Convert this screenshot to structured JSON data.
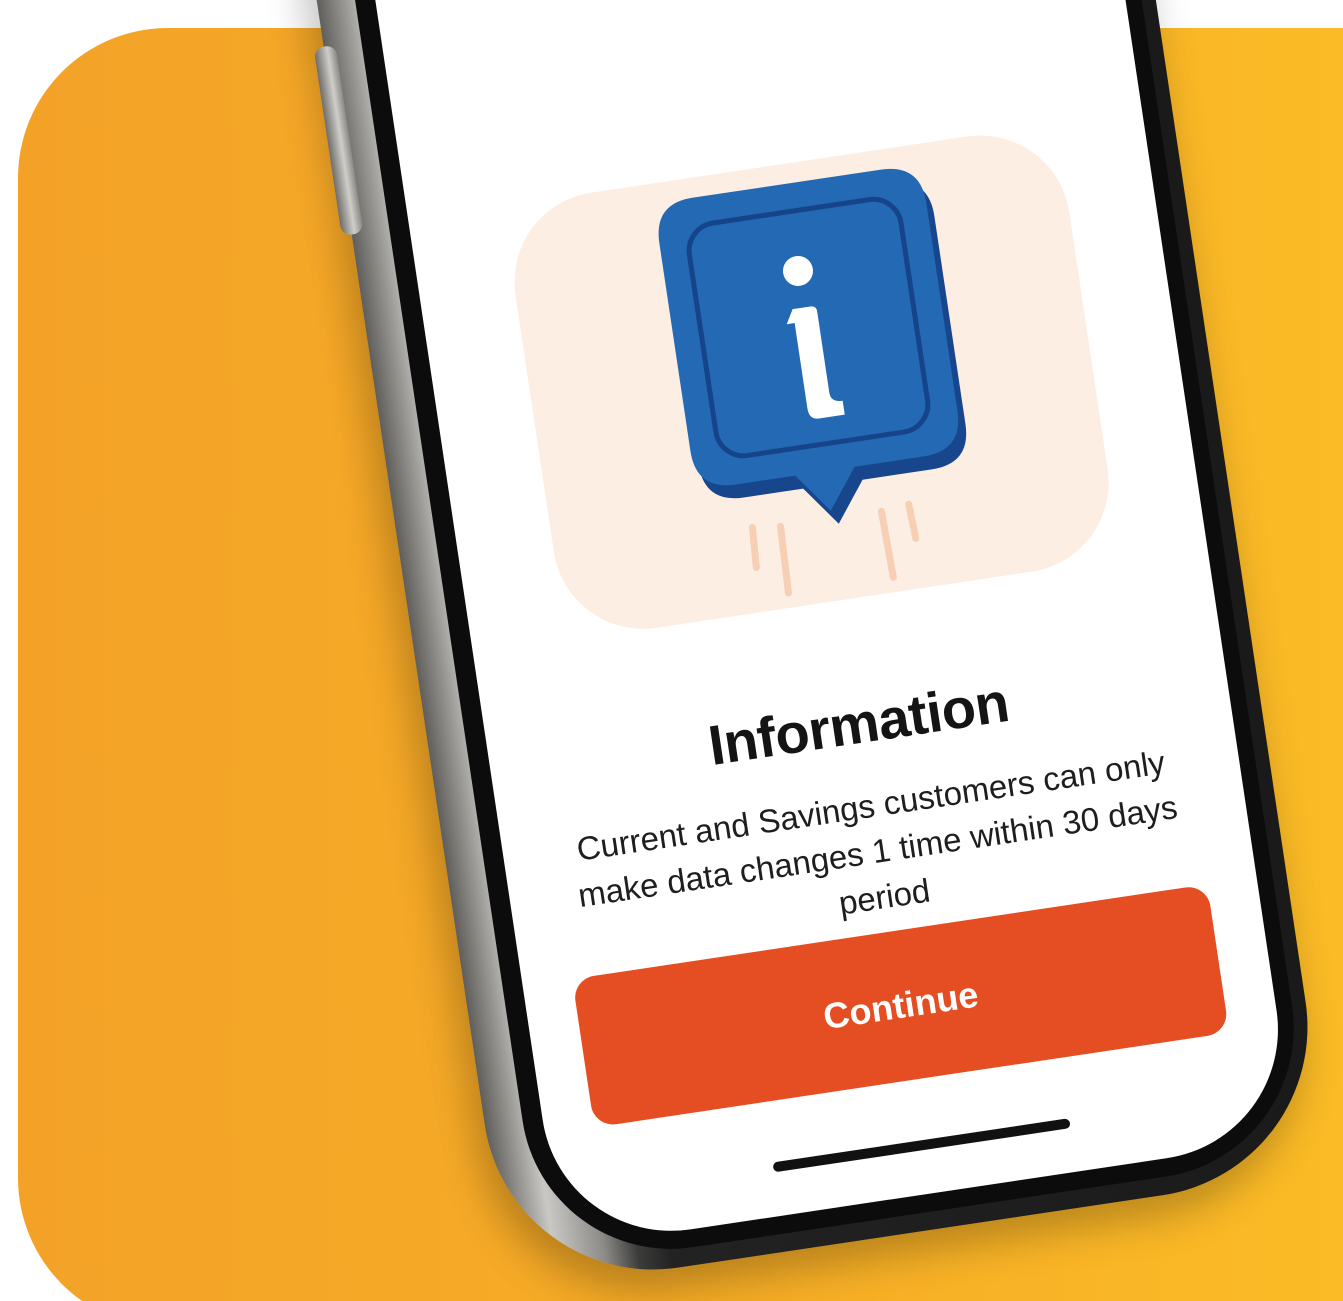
{
  "dialog": {
    "title": "Information",
    "message": "Current and Savings customers can only make data changes 1 time within 30 days period",
    "continue_label": "Continue"
  },
  "icons": {
    "illustration": "info-speech-bubble-icon"
  },
  "colors": {
    "background_orange": "#F5A623",
    "primary_button": "#E54E22",
    "info_blue": "#2469B3",
    "illustration_bg": "#FDEEE4"
  }
}
